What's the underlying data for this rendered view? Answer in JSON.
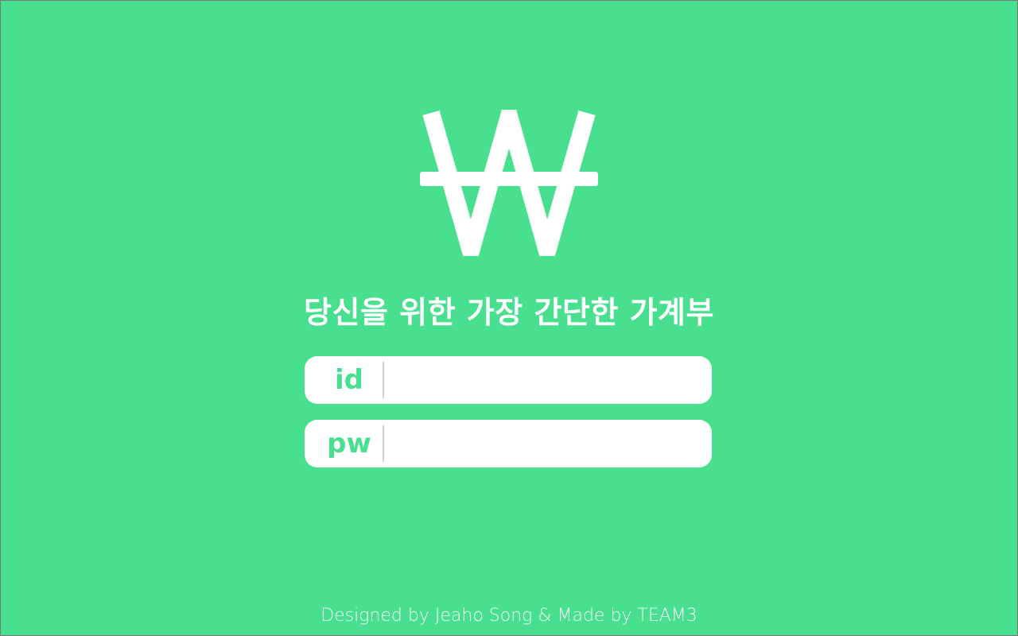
{
  "brand": {
    "logo_icon": "won-sign-icon",
    "tagline": "당신을 위한 가장 간단한 가계부"
  },
  "login": {
    "id_label": "id",
    "id_value": "",
    "pw_label": "pw",
    "pw_value": ""
  },
  "footer": {
    "credits": "Designed by Jeaho Song & Made by TEAM3"
  },
  "colors": {
    "background": "#48e08e",
    "text": "#ffffff",
    "field_bg": "#ffffff",
    "label": "#48e08e"
  }
}
